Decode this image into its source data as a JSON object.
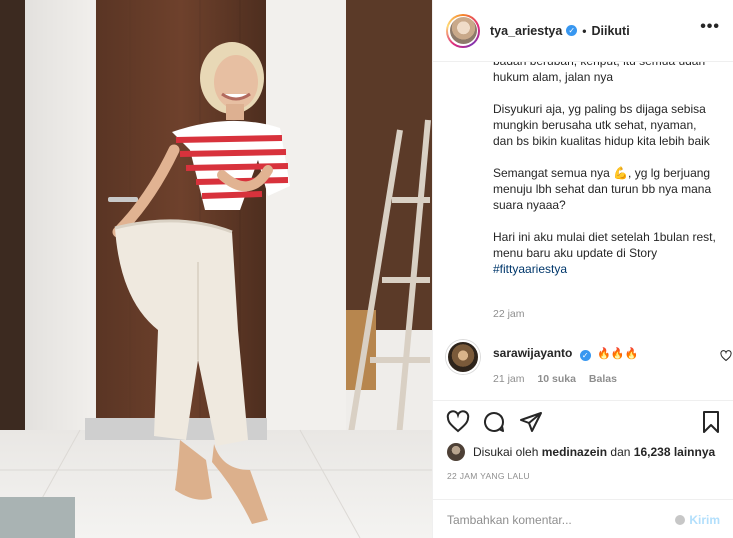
{
  "header": {
    "username": "tya_ariestya",
    "verified_icon": "verified-badge-icon",
    "separator": "•",
    "follow_status": "Diikuti",
    "more_icon": "more-options-icon"
  },
  "caption": {
    "paragraphs": [
      "badan beruban, keriput, itu semua udah hukum alam, jalan nya",
      "Disyukuri aja, yg paling bs dijaga sebisa mungkin berusaha utk sehat, nyaman, dan bs bikin kualitas hidup kita lebih baik",
      "Semangat semua nya",
      ", yg lg berjuang menuju lbh sehat dan turun bb nya mana suara nyaaa?",
      "Hari ini aku mulai diet setelah 1bulan rest, menu baru aku update di Story",
      "#fittyaariestya"
    ],
    "emoji": "💪",
    "time": "22 jam"
  },
  "comment": {
    "username": "sarawijayanto",
    "text": "🔥🔥🔥",
    "time": "21 jam",
    "likes": "10 suka",
    "reply": "Balas"
  },
  "likes": {
    "prefix": "Disukai oleh",
    "user": "medinazein",
    "conjunction": "dan",
    "count": "16,238 lainnya"
  },
  "post_date": "22 JAM YANG LALU",
  "comment_box": {
    "placeholder": "Tambahkan komentar...",
    "post_label": "Kirim"
  },
  "colors": {
    "link": "#00376b",
    "verified": "#3897f0",
    "muted": "#8e8e8e",
    "post_button": "#b2dffc"
  }
}
